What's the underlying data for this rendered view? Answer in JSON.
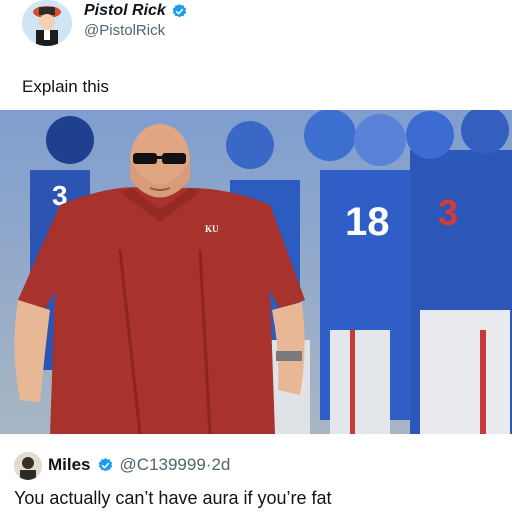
{
  "post": {
    "author_name": "Pistol Rick",
    "author_handle": "@PistolRick",
    "text": "Explain this",
    "image_logo_text": "KU",
    "jersey_numbers": [
      "18",
      "3",
      "3"
    ]
  },
  "reply": {
    "author_name": "Miles",
    "author_handle": "@C139999",
    "separator": "·",
    "time": "2d",
    "text": "You actually can’t have aura if you’re fat"
  },
  "colors": {
    "verified_blue": "#1d9bf0",
    "muted_text": "#536471",
    "shirt_red": "#a8322c",
    "jersey_blue": "#2a58b8"
  },
  "icons": {
    "verified": "verified-badge-icon"
  }
}
